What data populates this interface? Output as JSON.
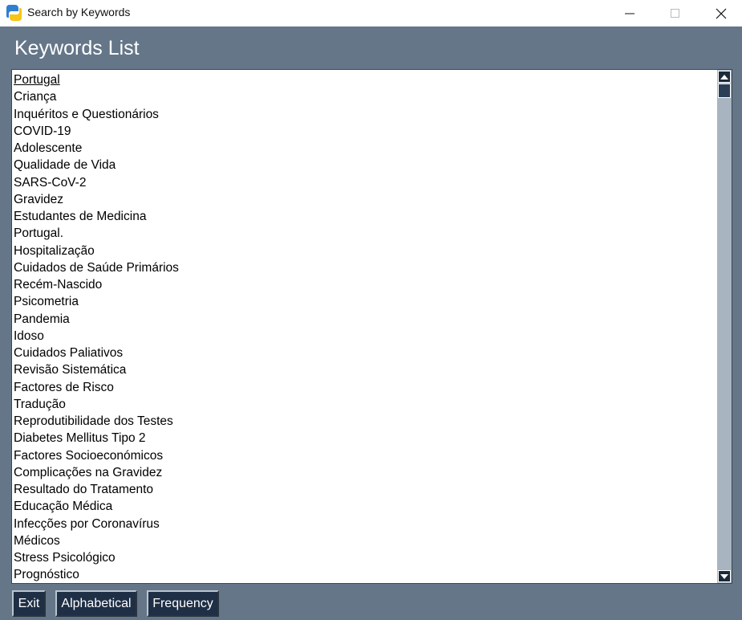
{
  "window": {
    "title": "Search by Keywords",
    "controls": {
      "minimize": "minimize-icon",
      "maximize": "maximize-icon",
      "close": "close-icon"
    }
  },
  "heading": "Keywords List",
  "keywords": [
    "Portugal",
    "Criança",
    "Inquéritos e Questionários",
    "COVID-19",
    "Adolescente",
    "Qualidade de Vida",
    "SARS-CoV-2",
    "Gravidez",
    "Estudantes de Medicina",
    "Portugal.",
    "Hospitalização",
    "Cuidados de Saúde Primários",
    "Recém-Nascido",
    "Psicometria",
    "Pandemia",
    "Idoso",
    "Cuidados Paliativos",
    "Revisão Sistemática",
    "Factores de Risco",
    "Tradução",
    "Reprodutibilidade dos Testes",
    "Diabetes Mellitus Tipo 2",
    "Factores Socioeconómicos",
    "Complicações na Gravidez",
    "Resultado do Tratamento",
    "Educação Médica",
    "Infecções por Coronavírus",
    "Médicos",
    "Stress Psicológico",
    "Prognóstico"
  ],
  "active_index": 0,
  "buttons": {
    "exit": "Exit",
    "alphabetical": "Alphabetical",
    "frequency": "Frequency"
  },
  "colors": {
    "background": "#657689",
    "button": "#1f2f45",
    "scrollbar_track": "#a8b4c0"
  }
}
